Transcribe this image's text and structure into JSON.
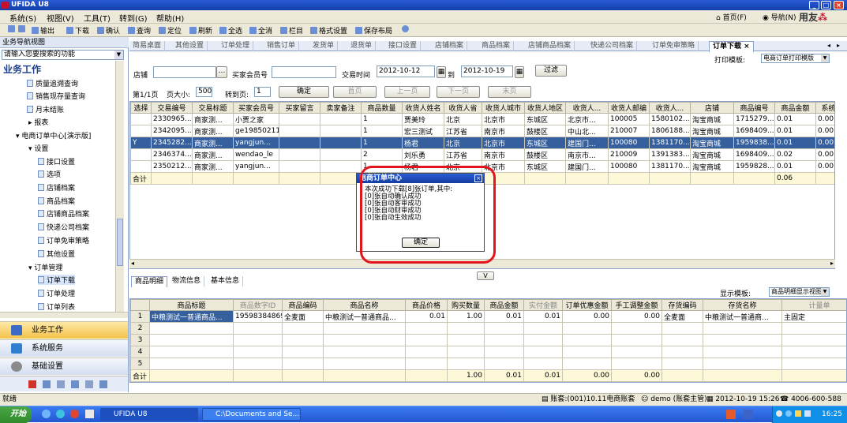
{
  "app": {
    "title": "UFIDA U8",
    "brand": "用友",
    "brand_accent": "#c8102e"
  },
  "menu": [
    "系统(S)",
    "视图(V)",
    "工具(T)",
    "转到(G)",
    "帮助(H)"
  ],
  "topright": {
    "home": "首页(F)",
    "nav": "导航(N)"
  },
  "toolbar": [
    "输出",
    "下载",
    "确认",
    "查询",
    "定位",
    "刷新",
    "全选",
    "全消",
    "栏目",
    "格式设置",
    "保存布局"
  ],
  "sidebar": {
    "header": "业务导航视图",
    "search_placeholder": "请输入您要搜索的功能",
    "title": "业务工作",
    "items": [
      "质量追溯查询",
      "销售现存量查询",
      "月末结账",
      "报表",
      "电商订单中心[演示版]",
      "设置",
      "接口设置",
      "选项",
      "店铺档案",
      "商品档案",
      "店铺商品档案",
      "快递公司档案",
      "订单免审策略",
      "其他设置",
      "订单管理",
      "订单下载",
      "订单处理",
      "订单列表"
    ],
    "nav": [
      "业务工作",
      "系统服务",
      "基础设置"
    ]
  },
  "tabs": [
    "简易桌面",
    "其他设置",
    "订单处理",
    "销售订单",
    "发货单",
    "退货单",
    "接口设置",
    "店铺档案",
    "商品档案",
    "店铺商品档案",
    "快递公司档案",
    "订单免审策略",
    "订单下载"
  ],
  "filter": {
    "print_template_label": "打印模板:",
    "print_template": "电商订单打印模版",
    "shop_label": "店铺",
    "member_label": "买家会员号",
    "time_label": "交易时间",
    "date_from": "2012-10-12",
    "to_label": "到",
    "date_to": "2012-10-19",
    "filter_btn": "过滤"
  },
  "pager": {
    "page": "第1/1页",
    "size_label": "页大小:",
    "size": "500",
    "goto_label": "转到页:",
    "goto": "1",
    "confirm": "确定",
    "first": "首页",
    "prev": "上一页",
    "next": "下一页",
    "last": "末页"
  },
  "orders": {
    "headers": [
      "选择",
      "交易编号",
      "交易标题",
      "买家会员号",
      "买家留言",
      "卖家备注",
      "商品数量",
      "收货人姓名",
      "收货人省",
      "收货人城市",
      "收货人地区",
      "收货人...",
      "收货人邮编",
      "收货人...",
      "店铺",
      "商品编号",
      "商品金额",
      "系统"
    ],
    "rows": [
      [
        "",
        "2330965...",
        "商家测...",
        "小贾之家",
        "",
        "",
        "1",
        "贾美玲",
        "北京",
        "北京市",
        "东城区",
        "北京市...",
        "100005",
        "1580102...",
        "淘宝商城",
        "1715279...",
        "0.01",
        "0.00"
      ],
      [
        "",
        "2342095...",
        "商家测...",
        "ge19850211",
        "",
        "",
        "1",
        "宏三测试",
        "江苏省",
        "南京市",
        "鼓楼区",
        "中山北...",
        "210007",
        "1806188...",
        "淘宝商城",
        "1698409...",
        "0.01",
        "0.00"
      ],
      [
        "Y",
        "2345282...",
        "商家测...",
        "yangjun...",
        "",
        "",
        "1",
        "杨君",
        "北京",
        "北京市",
        "东城区",
        "建国门...",
        "100080",
        "1381170...",
        "淘宝商城",
        "1959838...",
        "0.01",
        "0.00"
      ],
      [
        "",
        "2346374...",
        "商家测...",
        "wendao_le",
        "",
        "",
        "2",
        "刘乐勇",
        "江苏省",
        "南京市",
        "鼓楼区",
        "南京市...",
        "210009",
        "1391383...",
        "淘宝商城",
        "1698409...",
        "0.02",
        "0.00"
      ],
      [
        "",
        "2350212...",
        "商家测...",
        "yangjun...",
        "",
        "",
        "1",
        "杨君",
        "北京",
        "北京市",
        "东城区",
        "建国门...",
        "100080",
        "1381170...",
        "淘宝商城",
        "1959828...",
        "0.01",
        "0.00"
      ]
    ],
    "total_label": "合计",
    "total_qty": "6",
    "total_amount": "0.06"
  },
  "dialog": {
    "title": "电商订单中心",
    "lines": [
      "本次成功下载[8]张订单,其中:",
      "[0]张自动确认成功",
      "[0]张自动客审成功",
      "[0]张自动财审成功",
      "[0]张自动生效成功"
    ],
    "ok": "确定"
  },
  "collapse": "V",
  "bottomtabs": [
    "商品明细",
    "物流信息",
    "基本信息"
  ],
  "display_template_label": "显示模板:",
  "display_template": "商品明细显示视图",
  "details": {
    "headers": [
      "",
      "商品标题",
      "商品数字ID",
      "商品编码",
      "商品名称",
      "商品价格",
      "购买数量",
      "商品金额",
      "实付金额",
      "订单优惠金额",
      "手工调整金额",
      "存货编码",
      "存货名称",
      "计量单"
    ],
    "rows": [
      [
        "1",
        "中粮测试一普通商品...",
        "19598384869",
        "全麦面",
        "中粮测试一普通商品...",
        "0.01",
        "1.00",
        "0.01",
        "0.01",
        "0.00",
        "0.00",
        "全麦面",
        "中粮测试一普通商...",
        "主固定"
      ],
      [
        "2",
        "",
        "",
        "",
        "",
        "",
        "",
        "",
        "",
        "",
        "",
        "",
        "",
        ""
      ],
      [
        "3",
        "",
        "",
        "",
        "",
        "",
        "",
        "",
        "",
        "",
        "",
        "",
        "",
        ""
      ],
      [
        "4",
        "",
        "",
        "",
        "",
        "",
        "",
        "",
        "",
        "",
        "",
        "",
        "",
        ""
      ],
      [
        "5",
        "",
        "",
        "",
        "",
        "",
        "",
        "",
        "",
        "",
        "",
        "",
        "",
        ""
      ]
    ],
    "total": [
      "合计",
      "",
      "",
      "",
      "",
      "",
      "1.00",
      "0.01",
      "0.01",
      "0.00",
      "0.00",
      "",
      "",
      ""
    ]
  },
  "status": {
    "ready": "就绪",
    "account": "账套:(001)10.11电商账套",
    "user": "demo (账套主管)",
    "datetime": "2012-10-19 15:26",
    "phone": "4006-600-588"
  },
  "taskbar": {
    "start": "开始",
    "items": [
      "UFIDA U8",
      "C:\\Documents and Se..."
    ],
    "clock": "16:25"
  }
}
